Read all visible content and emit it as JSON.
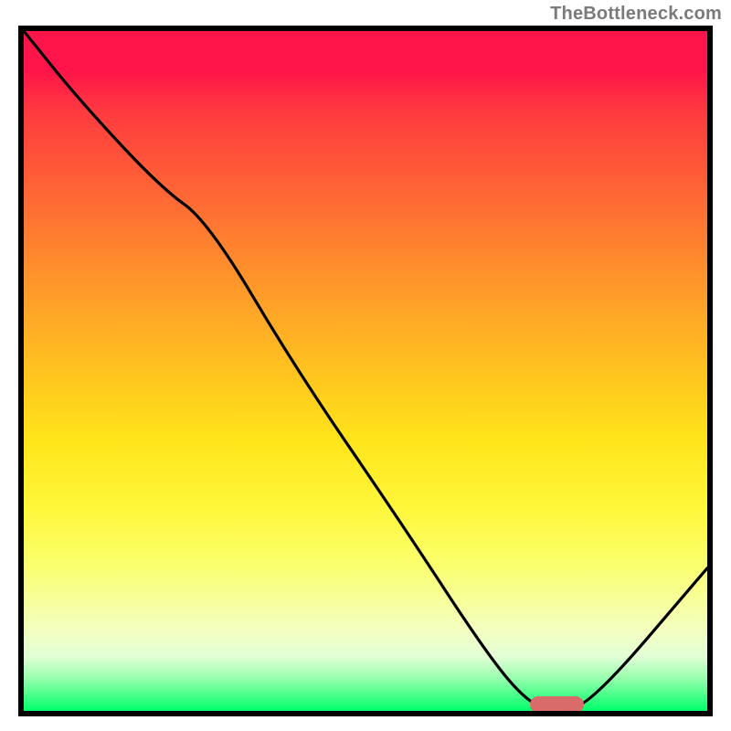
{
  "watermark": "TheBottleneck.com",
  "chart_data": {
    "type": "line",
    "title": "",
    "xlabel": "",
    "ylabel": "",
    "xlim": [
      0,
      100
    ],
    "ylim": [
      0,
      100
    ],
    "series": [
      {
        "name": "bottleneck-curve",
        "x": [
          0,
          8,
          20,
          27,
          40,
          55,
          68,
          74,
          78,
          83,
          100
        ],
        "values": [
          100,
          90,
          77,
          72,
          50,
          28,
          8,
          1,
          0,
          1,
          21
        ]
      }
    ],
    "marker": {
      "x_start": 74,
      "x_end": 82,
      "y": 1,
      "color": "#d96b6b"
    },
    "gradient_stops": [
      {
        "pos": 0,
        "color": "#ff1549"
      },
      {
        "pos": 25,
        "color": "#ff6a34"
      },
      {
        "pos": 50,
        "color": "#ffc31f"
      },
      {
        "pos": 78,
        "color": "#fbff6a"
      },
      {
        "pos": 100,
        "color": "#00ff6a"
      }
    ]
  }
}
